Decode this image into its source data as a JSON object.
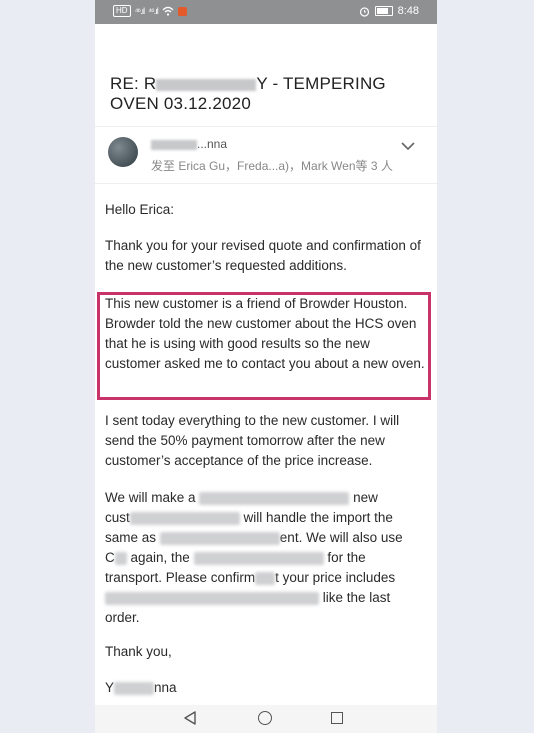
{
  "status_bar": {
    "left_badge": "HD",
    "signal1": "⁴⁶.ıl",
    "signal2": "⁴⁶.ıl",
    "time": "8:48"
  },
  "email": {
    "subject_prefix": "RE: R",
    "subject_suffix": "Y - TEMPERING",
    "subject_line2": "OVEN 03.12.2020",
    "sender_suffix": "...nna",
    "recipients": "发至 Erica Gu，Freda...a)，Mark Wen等 3 人",
    "greeting": "Hello Erica:",
    "para1": "Thank you for your revised quote and confirmation of the new customer’s requested additions.",
    "highlight": "This new customer is a friend of Browder Houston. Browder told the new customer about the HCS oven that he is using with good results so the new customer asked me to contact you about a new oven.",
    "para3": "I sent today everything to the new customer. I will send the 50% payment tomorrow after the new customer’s acceptance of the price increase.",
    "p4_l1a": "We will make a",
    "p4_l1b": "new",
    "p4_l2a": "cust",
    "p4_l2b": "will handle the import the",
    "p4_l3a": "same as",
    "p4_l3b": "ent. We will also use",
    "p4_l4a": "C",
    "p4_l4b": "again, the",
    "p4_l4c": "for the",
    "p4_l5a": "transport. Please confirm",
    "p4_l5b": "t your price includes",
    "p4_l6b": "like the last",
    "p4_l7": "order.",
    "thanks": "Thank you,",
    "signature": "Y",
    "signature2": "nna"
  }
}
